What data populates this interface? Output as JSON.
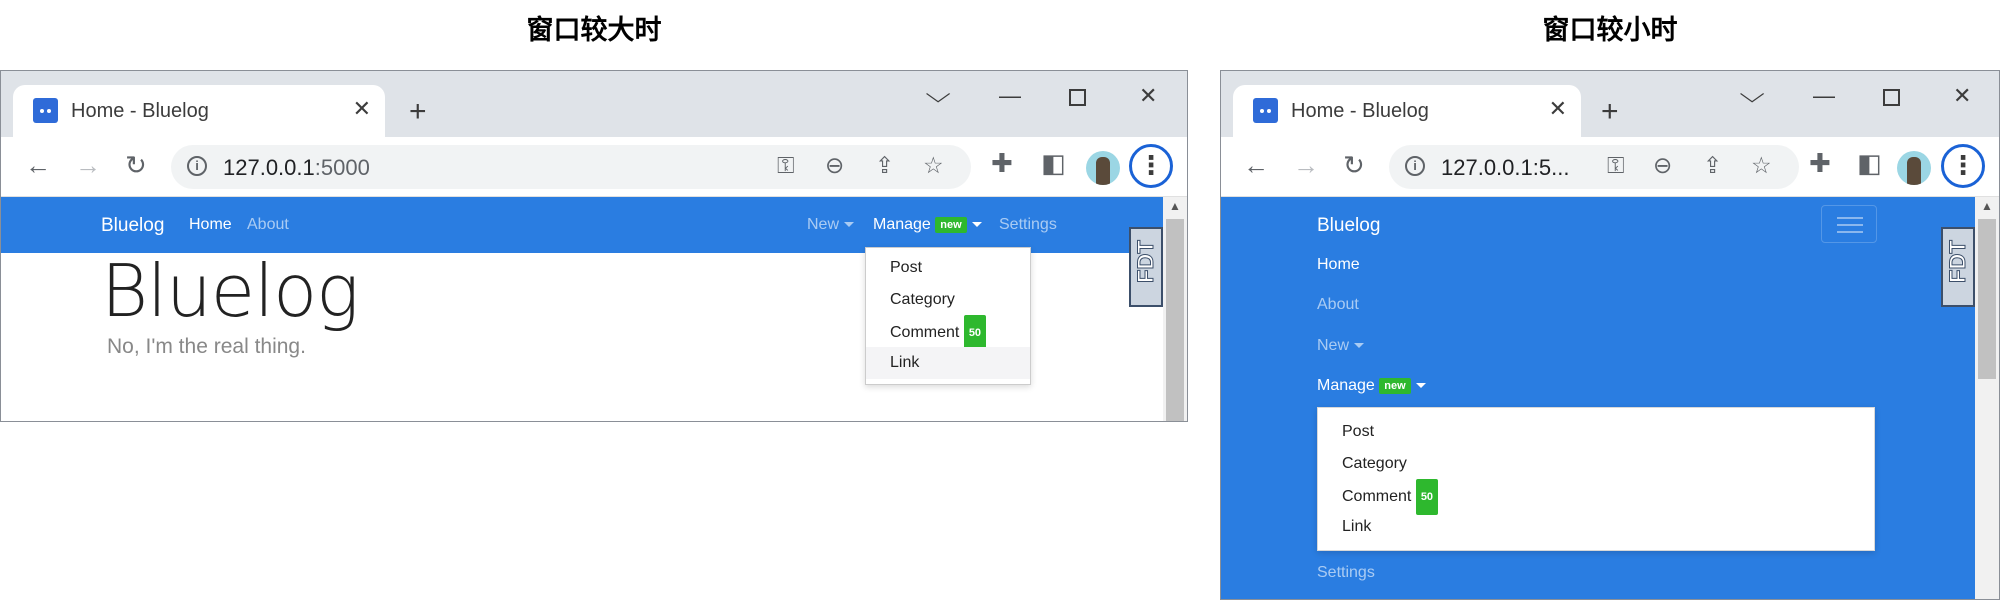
{
  "captions": {
    "left": "窗口较大时",
    "right": "窗口较小时"
  },
  "browser": {
    "tab_title": "Home - Bluelog",
    "tab_close": "✕",
    "new_tab": "+",
    "url_host": "127.0.0.1",
    "url_port": ":5000",
    "url_truncated": "127.0.0.1:5...",
    "icons": [
      "back-icon",
      "forward-icon",
      "reload-icon",
      "info-icon",
      "key-icon",
      "zoom-icon",
      "share-icon",
      "star-icon",
      "extensions-icon",
      "side-panel-icon",
      "avatar",
      "menu-icon"
    ],
    "window_controls": {
      "chevron": "⌵",
      "minimize": "—",
      "close": "✕"
    }
  },
  "site": {
    "brand": "Bluelog",
    "nav": {
      "home": "Home",
      "about": "About",
      "new": "New",
      "manage": "Manage",
      "manage_badge": "new",
      "settings": "Settings"
    },
    "manage_menu": {
      "post": "Post",
      "category": "Category",
      "comment": "Comment",
      "comment_count": "50",
      "link": "Link"
    },
    "jumbotron": {
      "title": "Bluelog",
      "subtitle": "No, I'm the real thing."
    },
    "fdt_label": "FDT"
  },
  "colors": {
    "navbar": "#2a7de1",
    "badge": "#2eb82e",
    "focus_ring": "#1a62d6"
  }
}
